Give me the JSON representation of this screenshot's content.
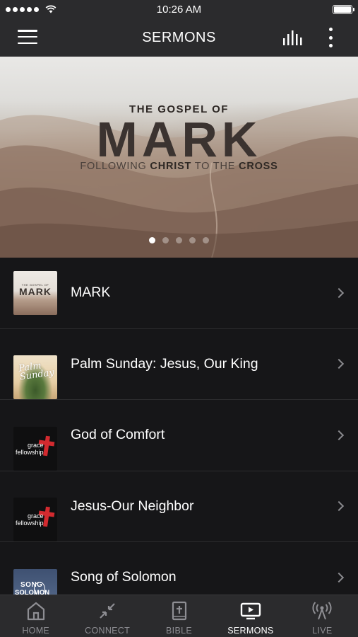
{
  "status_bar": {
    "time": "10:26 AM"
  },
  "header": {
    "title": "SERMONS"
  },
  "hero": {
    "kicker": "THE GOSPEL OF",
    "title": "MARK",
    "tagline_parts": [
      "FOLLOWING ",
      "CHRIST",
      " TO THE ",
      "CROSS"
    ],
    "page_count": 5,
    "active_page": 1
  },
  "sermons": [
    {
      "title": "MARK",
      "thumb": "mark-series-art"
    },
    {
      "title": "Palm Sunday: Jesus, Our King",
      "thumb": "palm-sunday-art",
      "thumb_text": "Palm Sunday"
    },
    {
      "title": "God of Comfort",
      "thumb": "grace-fellowship-logo",
      "thumb_text_1": "grace",
      "thumb_text_2": "fellowship"
    },
    {
      "title": "Jesus-Our Neighbor",
      "thumb": "grace-fellowship-logo",
      "thumb_text_1": "grace",
      "thumb_text_2": "fellowship"
    },
    {
      "title": "Song of Solomon",
      "thumb": "song-of-solomon-art",
      "thumb_text_1": "SONG",
      "thumb_text_2": "SOLOMON"
    }
  ],
  "tabs": [
    {
      "label": "HOME",
      "icon": "home-icon",
      "active": false
    },
    {
      "label": "CONNECT",
      "icon": "connect-icon",
      "active": false
    },
    {
      "label": "BIBLE",
      "icon": "bible-icon",
      "active": false
    },
    {
      "label": "SERMONS",
      "icon": "play-screen-icon",
      "active": true
    },
    {
      "label": "LIVE",
      "icon": "broadcast-icon",
      "active": false
    }
  ],
  "colors": {
    "bar": "#2b2b2d",
    "background": "#161618",
    "accent_red": "#d22a2f",
    "inactive": "#8e8e93"
  }
}
